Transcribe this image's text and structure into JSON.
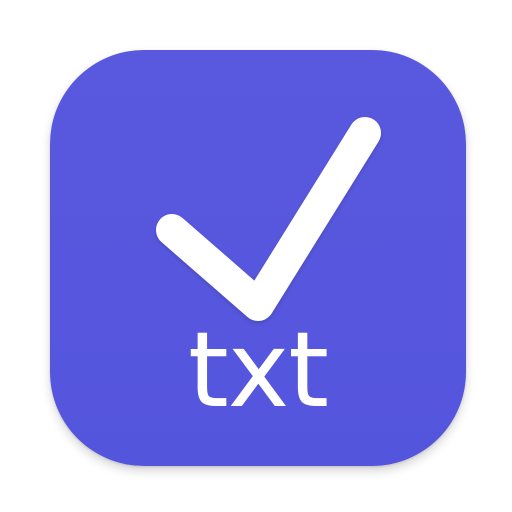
{
  "icon": {
    "label": "txt",
    "symbol": "checkmark-icon",
    "background_color": "#5557DE",
    "foreground_color": "#FFFFFF"
  }
}
